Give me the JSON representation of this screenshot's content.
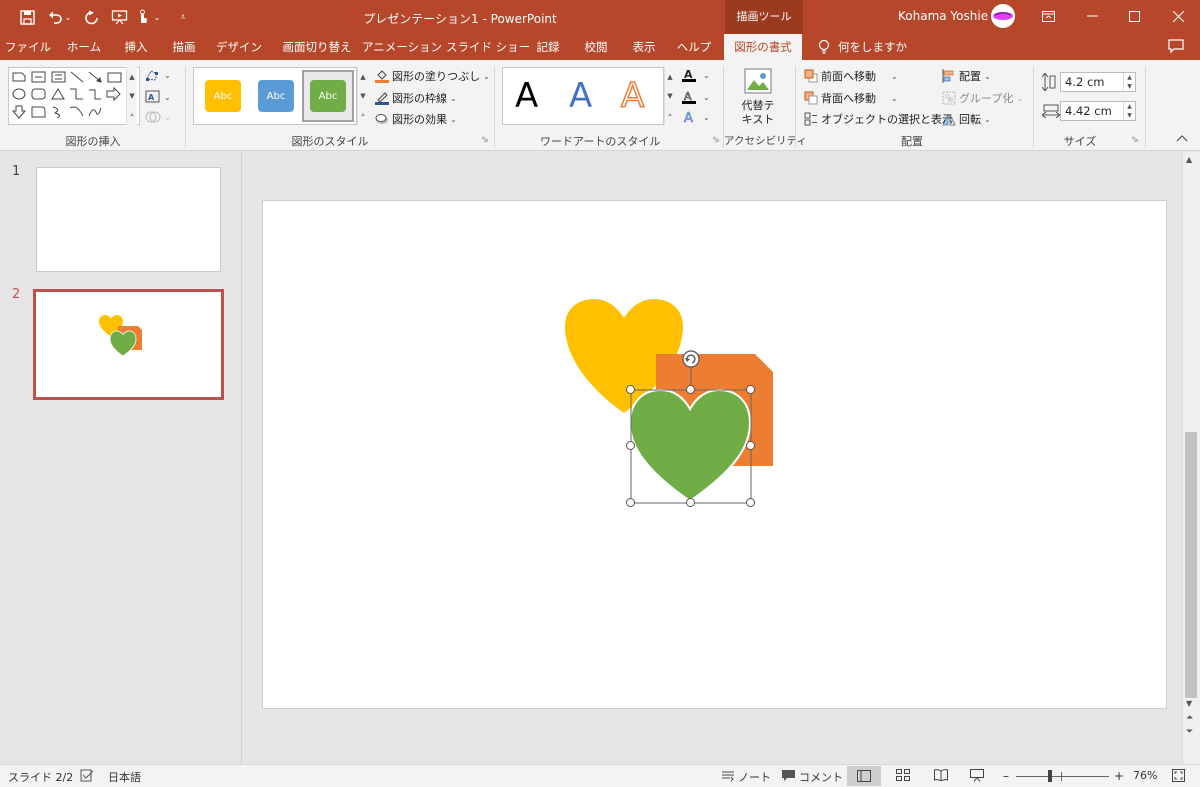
{
  "window": {
    "title": "プレゼンテーション1 - PowerPoint",
    "context_tab": "描画ツール",
    "user": "Kohama Yoshie"
  },
  "tabs": [
    "ファイル",
    "ホーム",
    "挿入",
    "描画",
    "デザイン",
    "画面切り替え",
    "アニメーション",
    "スライド ショー",
    "記録",
    "校閲",
    "表示",
    "ヘルプ",
    "図形の書式"
  ],
  "tell_me": "何をしますか",
  "ribbon": {
    "groups": {
      "insert_shapes": "図形の挿入",
      "shape_styles": "図形のスタイル",
      "wordart_styles": "ワードアートのスタイル",
      "accessibility": "アクセシビリティ",
      "arrange": "配置",
      "size": "サイズ"
    },
    "style_samples": [
      "Abc",
      "Abc",
      "Abc"
    ],
    "style_colors": [
      "#ffc000",
      "#5b9bd5",
      "#70ad47"
    ],
    "shape_fill": "図形の塗りつぶし",
    "shape_outline": "図形の枠線",
    "shape_effects": "図形の効果",
    "wordart_letters": [
      "A",
      "A",
      "A"
    ],
    "alt_text": [
      "代替テ",
      "キスト"
    ],
    "bring_forward": "前面へ移動",
    "send_backward": "背面へ移動",
    "selection_pane": "オブジェクトの選択と表示",
    "align": "配置",
    "group": "グループ化",
    "rotate": "回転",
    "height": "4.2 cm",
    "width": "4.42 cm"
  },
  "thumbnails": [
    "1",
    "2"
  ],
  "slide": {
    "shapes": [
      {
        "name": "yellow heart",
        "color": "#ffc000"
      },
      {
        "name": "orange snip rectangle",
        "color": "#ed7d31"
      },
      {
        "name": "green heart",
        "color": "#70ad47",
        "selected": true
      }
    ]
  },
  "status": {
    "slide_indicator": "スライド 2/2",
    "language": "日本語",
    "notes": "ノート",
    "comments": "コメント",
    "zoom": "76%"
  }
}
